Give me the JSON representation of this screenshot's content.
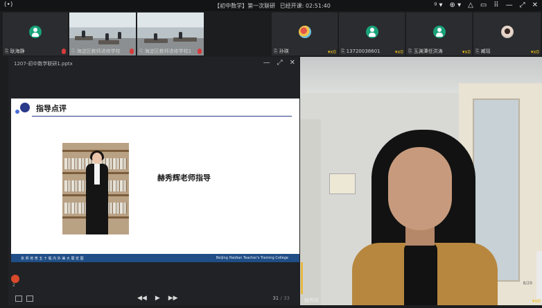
{
  "topbar": {
    "live": "(•)",
    "meeting_title": "【初中数学】第一次联研",
    "elapsed_label": "已经开课: 02:51:40",
    "controls": [
      "ᵍ ▾",
      "⊕ ▾",
      "△",
      "▭",
      "⠿",
      "—",
      "⤢",
      "✕"
    ]
  },
  "participants": [
    {
      "name": "耿海静",
      "type": "avatar",
      "mic_muted": true
    },
    {
      "name": "海淀区教师进修学校",
      "type": "classroom",
      "mic_muted": true
    },
    {
      "name": "海淀区教师进修学校1",
      "type": "classroom",
      "mic_muted": true
    },
    {
      "name": "孙瑛",
      "type": "img1",
      "badge": "x0"
    },
    {
      "name": "13720038601",
      "type": "avatar",
      "badge": "x0"
    },
    {
      "name": "玉渊潭任洪涛",
      "type": "avatar",
      "badge": "x0"
    },
    {
      "name": "臧瑶",
      "type": "img2",
      "badge": "x0"
    }
  ],
  "presentation": {
    "file_name": "1207-初中数学联研1.pptx",
    "window_buttons": [
      "—",
      "⤢",
      "✕"
    ],
    "slide_title": "指导点评",
    "slide_caption": "赫秀辉老师指导",
    "footer_left": "京 师 培 育 五 十 载  内 外 兼 大 展 宏 图",
    "footer_right": "Beijing Haidian Teacher's Training College",
    "thumb_badge": "2",
    "nav": [
      "◀◀",
      "▶",
      "▶▶"
    ],
    "page_current": "31",
    "page_total": "/ 33"
  },
  "video": {
    "name": "赫秀辉",
    "counter": "8/29",
    "badge": "x0"
  }
}
